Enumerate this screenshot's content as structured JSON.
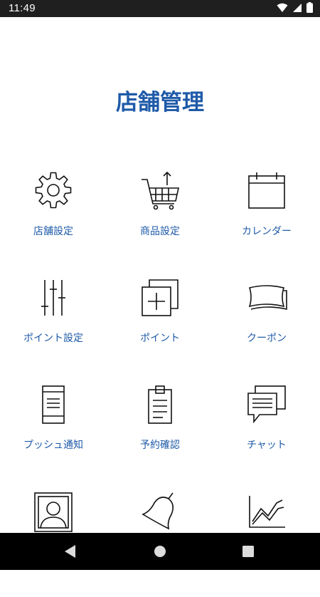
{
  "status_bar": {
    "time": "11:49",
    "icons": [
      "wifi-icon",
      "signal-icon",
      "battery-icon"
    ]
  },
  "header": {
    "title": "店舗管理"
  },
  "menu": {
    "items": [
      {
        "label": "店舗設定",
        "icon": "gear-icon"
      },
      {
        "label": "商品設定",
        "icon": "shopping-cart-icon"
      },
      {
        "label": "カレンダー",
        "icon": "calendar-icon"
      },
      {
        "label": "ポイント設定",
        "icon": "sliders-icon"
      },
      {
        "label": "ポイント",
        "icon": "add-card-icon"
      },
      {
        "label": "クーポン",
        "icon": "coupon-icon"
      },
      {
        "label": "プッシュ通知",
        "icon": "smartphone-icon"
      },
      {
        "label": "予約確認",
        "icon": "clipboard-icon"
      },
      {
        "label": "チャット",
        "icon": "chat-icon"
      },
      {
        "label": "",
        "icon": "user-portrait-icon"
      },
      {
        "label": "",
        "icon": "bell-icon"
      },
      {
        "label": "",
        "icon": "line-chart-icon"
      }
    ]
  },
  "nav_bar": {
    "buttons": [
      "back-icon",
      "home-icon",
      "recents-icon"
    ]
  },
  "colors": {
    "accent": "#1e5aa8",
    "status_bar": "#1f1f1f",
    "nav_bar": "#000000"
  }
}
